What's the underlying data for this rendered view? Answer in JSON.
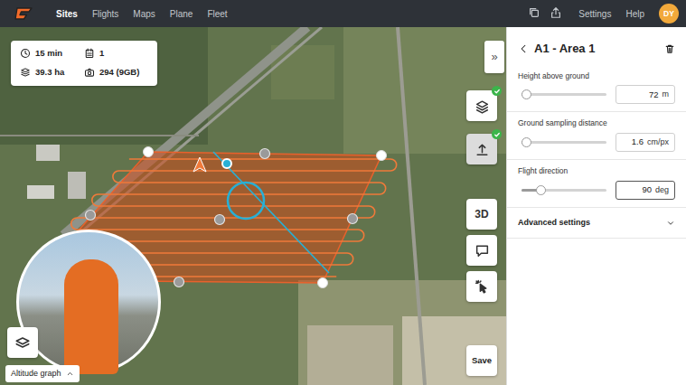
{
  "navbar": {
    "items": [
      {
        "label": "Sites",
        "selected": true
      },
      {
        "label": "Flights",
        "selected": false
      },
      {
        "label": "Maps",
        "selected": false
      },
      {
        "label": "Plane",
        "selected": false
      },
      {
        "label": "Fleet",
        "selected": false
      }
    ],
    "links": [
      "Settings",
      "Help"
    ],
    "avatar": "DY"
  },
  "map": {
    "stats": [
      {
        "kind": "duration",
        "value": "15 min"
      },
      {
        "kind": "batteries",
        "value": "1"
      },
      {
        "kind": "area",
        "value": "39.3 ha"
      },
      {
        "kind": "photos",
        "value": "294 (9GB)"
      }
    ],
    "collapse": "»",
    "layer_tools": [
      {
        "checked": true
      },
      {
        "checked": true
      }
    ],
    "view_toggle": "3D",
    "altitude_graph": {
      "label": "Altitude graph",
      "expanded": false
    },
    "save": "Save"
  },
  "panel": {
    "title": "A1 - Area 1",
    "fields": [
      {
        "label": "Height above ground",
        "level": 0.05,
        "value": "72",
        "unit": "m",
        "focused": false
      },
      {
        "label": "Ground sampling distance",
        "level": 0.05,
        "value": "1.6",
        "unit": "cm/px",
        "focused": false
      },
      {
        "label": "Flight direction",
        "level": 0.22,
        "value": "90",
        "unit": "deg",
        "focused": true
      }
    ],
    "advanced": {
      "label": "Advanced settings",
      "expanded": false
    }
  }
}
